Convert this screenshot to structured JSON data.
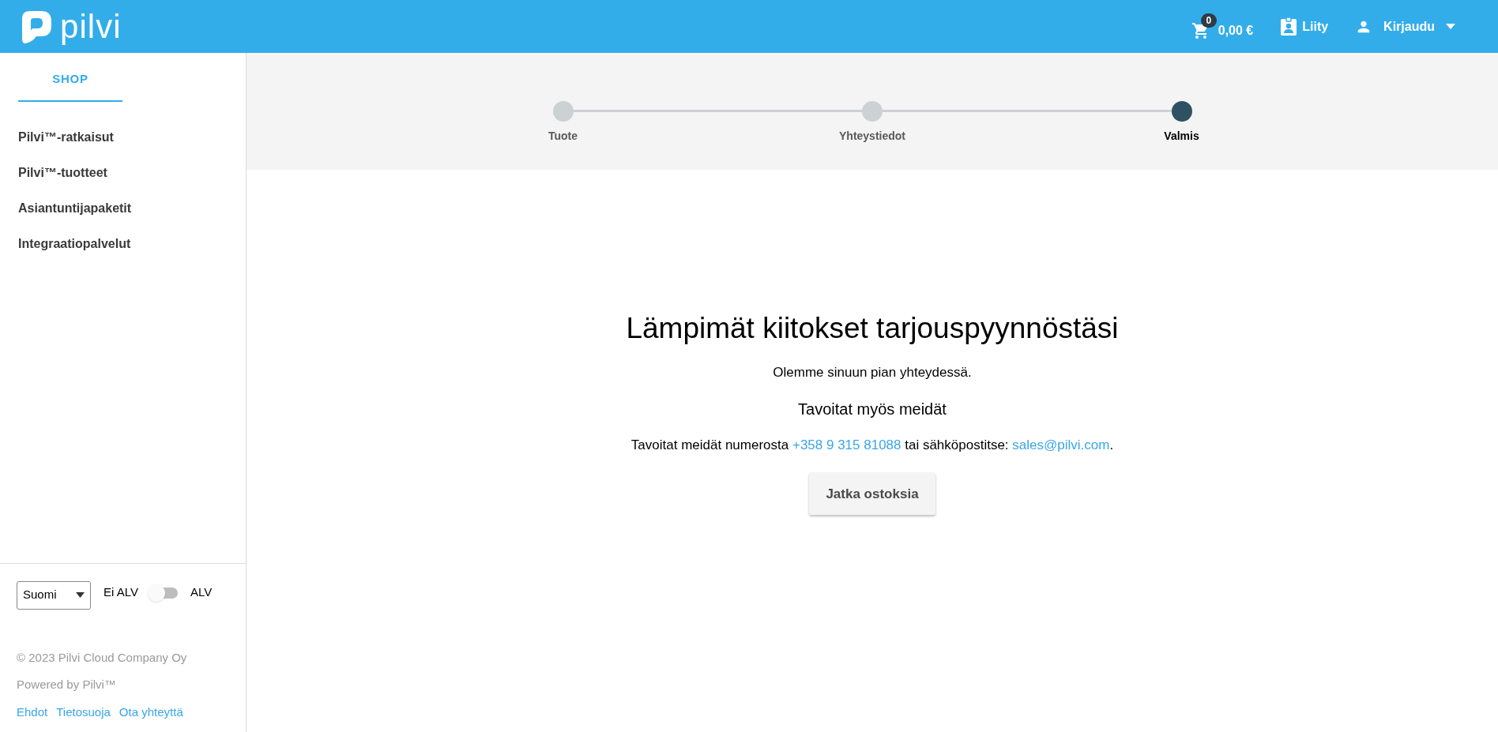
{
  "header": {
    "logo_text": "pilvi",
    "cart": {
      "count": "0",
      "total": "0,00 €"
    },
    "join": "Liity",
    "login": "Kirjaudu"
  },
  "sidebar": {
    "tab": "SHOP",
    "items": [
      {
        "label": "Pilvi™-ratkaisut"
      },
      {
        "label": "Pilvi™-tuotteet"
      },
      {
        "label": "Asiantuntijapaketit"
      },
      {
        "label": "Integraatiopalvelut"
      }
    ],
    "language": "Suomi",
    "vat_toggle": {
      "off_label": "Ei ALV",
      "on_label": "ALV",
      "on": false
    },
    "copyright": "© 2023 Pilvi Cloud Company Oy",
    "powered": "Powered by Pilvi™",
    "links": [
      "Ehdot",
      "Tietosuoja",
      "Ota yhteyttä"
    ]
  },
  "stepper": [
    {
      "label": "Tuote",
      "selected": false
    },
    {
      "label": "Yhteystiedot",
      "selected": false
    },
    {
      "label": "Valmis",
      "selected": true
    }
  ],
  "content": {
    "title": "Lämpimät kiitokset tarjouspyynnöstäsi",
    "subtitle": "Olemme sinuun pian yhteydessä.",
    "contact_heading": "Tavoitat myös meidät",
    "contact_parts": [
      {
        "kind": "text",
        "text": "Tavoitat meidät numerosta "
      },
      {
        "kind": "link",
        "text": "+358 9 315 81088"
      },
      {
        "kind": "text",
        "text": " tai sähköpostitse: "
      },
      {
        "kind": "link",
        "text": "sales@pilvi.com"
      },
      {
        "kind": "text",
        "text": "."
      }
    ],
    "button": "Jatka ostoksia"
  }
}
